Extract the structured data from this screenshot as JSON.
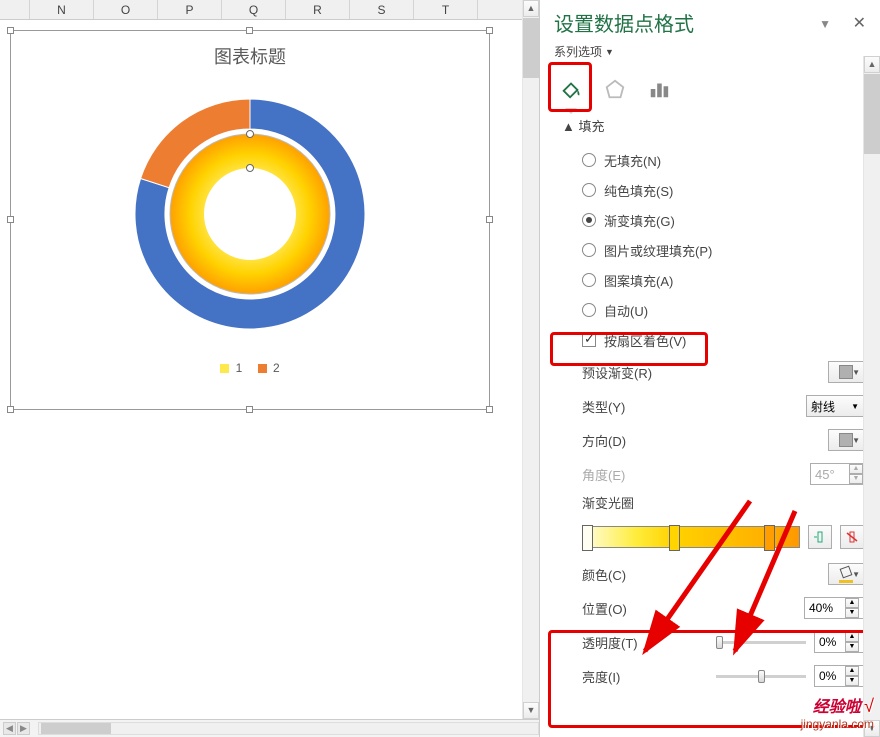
{
  "columns": [
    "",
    "N",
    "O",
    "P",
    "Q",
    "R",
    "S",
    "T"
  ],
  "chart": {
    "title": "图表标题",
    "legend": [
      {
        "label": "1",
        "color": "#ffe94a"
      },
      {
        "label": "2",
        "color": "#ed7d31"
      }
    ]
  },
  "chart_data": {
    "type": "pie",
    "variant": "double_donut",
    "title": "图表标题",
    "series": [
      {
        "name": "outer",
        "slices": [
          {
            "label": "1",
            "value": 70,
            "color": "#4472c4"
          },
          {
            "label": "2",
            "value": 30,
            "color": "#ed7d31"
          }
        ]
      },
      {
        "name": "inner",
        "slices": [
          {
            "label": "1",
            "value": 100,
            "color_gradient": [
              "#fff176",
              "#ffd200",
              "#ffa000"
            ]
          }
        ]
      }
    ],
    "legend": [
      "1",
      "2"
    ]
  },
  "panel": {
    "title": "设置数据点格式",
    "series_options": "系列选项",
    "fill_section": "填充",
    "options": {
      "no_fill": "无填充(N)",
      "solid_fill": "纯色填充(S)",
      "gradient_fill": "渐变填充(G)",
      "picture_fill": "图片或纹理填充(P)",
      "pattern_fill": "图案填充(A)",
      "auto": "自动(U)",
      "vary_by_slice": "按扇区着色(V)"
    },
    "props": {
      "preset_gradient": "预设渐变(R)",
      "type": "类型(Y)",
      "type_value": "射线",
      "direction": "方向(D)",
      "angle": "角度(E)",
      "angle_value": "45°",
      "gradient_stops": "渐变光圈",
      "color": "颜色(C)",
      "position": "位置(O)",
      "position_value": "40%",
      "transparency": "透明度(T)",
      "transparency_value": "0%",
      "brightness": "亮度(I)",
      "brightness_value": "0%"
    }
  },
  "watermark": {
    "brand": "经验啦",
    "url": "jingyanla.com"
  }
}
